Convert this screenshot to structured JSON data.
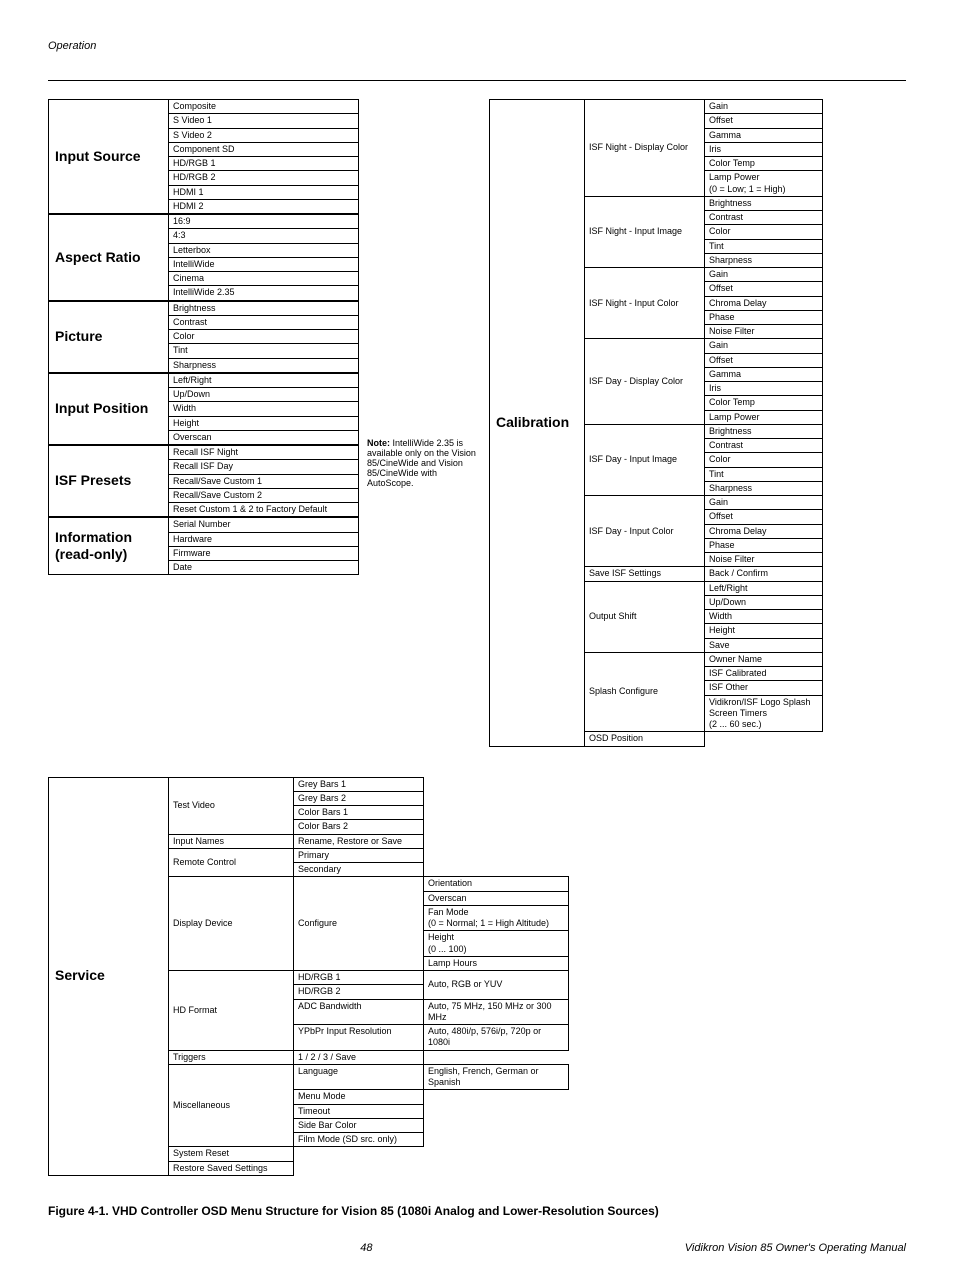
{
  "header": {
    "section": "Operation"
  },
  "left_menus": [
    {
      "title": "Input Source",
      "items": [
        "Composite",
        "S Video 1",
        "S Video 2",
        "Component SD",
        "HD/RGB 1",
        "HD/RGB 2",
        "HDMI 1",
        "HDMI 2"
      ]
    },
    {
      "title": "Aspect Ratio",
      "items": [
        "16:9",
        "4:3",
        "Letterbox",
        "IntelliWide",
        "Cinema",
        "IntelliWide 2.35"
      ]
    },
    {
      "title": "Picture",
      "items": [
        "Brightness",
        "Contrast",
        "Color",
        "Tint",
        "Sharpness"
      ]
    },
    {
      "title": "Input Position",
      "items": [
        "Left/Right",
        "Up/Down",
        "Width",
        "Height",
        "Overscan"
      ]
    },
    {
      "title": "ISF Presets",
      "items": [
        "Recall ISF Night",
        "Recall ISF Day",
        "Recall/Save Custom 1",
        "Recall/Save Custom 2",
        "Reset Custom 1 & 2 to Factory Default"
      ]
    },
    {
      "title": "Information (read-only)",
      "items": [
        "Serial Number",
        "Hardware",
        "Firmware",
        "Date"
      ]
    }
  ],
  "note": {
    "bold": "Note:",
    "text": " IntelliWide 2.35 is available only on the Vision 85/CineWide and Vision 85/CineWide with AutoScope."
  },
  "calibration": {
    "title": "Calibration",
    "groups": [
      {
        "label": "ISF Night - Display Color",
        "items": [
          "Gain",
          "Offset",
          "Gamma",
          "Iris",
          "Color Temp",
          "Lamp Power\n(0 = Low; 1 = High)"
        ]
      },
      {
        "label": "ISF Night - Input Image",
        "items": [
          "Brightness",
          "Contrast",
          "Color",
          "Tint",
          "Sharpness"
        ]
      },
      {
        "label": "ISF Night - Input Color",
        "items": [
          "Gain",
          "Offset",
          "Chroma Delay",
          "Phase",
          "Noise Filter"
        ]
      },
      {
        "label": "ISF Day - Display Color",
        "items": [
          "Gain",
          "Offset",
          "Gamma",
          "Iris",
          "Color Temp",
          "Lamp Power"
        ]
      },
      {
        "label": "ISF Day - Input Image",
        "items": [
          "Brightness",
          "Contrast",
          "Color",
          "Tint",
          "Sharpness"
        ]
      },
      {
        "label": "ISF Day - Input Color",
        "items": [
          "Gain",
          "Offset",
          "Chroma Delay",
          "Phase",
          "Noise Filter"
        ]
      },
      {
        "label": "Save ISF Settings",
        "items": [
          "Back / Confirm"
        ]
      },
      {
        "label": "Output Shift",
        "items": [
          "Left/Right",
          "Up/Down",
          "Width",
          "Height",
          "Save"
        ]
      },
      {
        "label": "Splash Configure",
        "items": [
          "Owner Name",
          "ISF Calibrated",
          "ISF Other",
          "Vidikron/ISF Logo Splash Screen Timers\n(2 ... 60 sec.)"
        ]
      },
      {
        "label": "OSD Position",
        "items": []
      }
    ]
  },
  "service": {
    "title": "Service",
    "rows": [
      {
        "sub": "Test Video",
        "sub2": [
          "Grey Bars 1",
          "Grey Bars 2",
          "Color Bars 1",
          "Color Bars 2"
        ],
        "sub3": []
      },
      {
        "sub": "Input Names",
        "sub2": [
          "Rename, Restore or Save"
        ],
        "sub3": []
      },
      {
        "sub": "Remote Control",
        "sub2": [
          "Primary",
          "Secondary"
        ],
        "sub3": []
      },
      {
        "sub": "Display Device",
        "sub2": [
          "Configure"
        ],
        "sub3": [
          "Orientation",
          "Overscan",
          "Fan Mode\n(0 = Normal; 1 = High Altitude)",
          "Height\n(0 ... 100)",
          "Lamp Hours"
        ]
      },
      {
        "sub": "HD Format",
        "sub2": [
          "HD/RGB 1",
          "HD/RGB 2",
          "ADC Bandwidth",
          "YPbPr Input Resolution"
        ],
        "sub3": [
          "Auto, RGB or YUV",
          "",
          "Auto, 75 MHz, 150 MHz or 300 MHz",
          "Auto, 480i/p, 576i/p, 720p or 1080i"
        ]
      },
      {
        "sub": "Triggers",
        "sub2": [
          "1 / 2 / 3 / Save"
        ],
        "sub3": []
      },
      {
        "sub": "Miscellaneous",
        "sub2": [
          "Language",
          "Menu Mode",
          "Timeout",
          "Side Bar Color",
          "Film Mode (SD src. only)"
        ],
        "sub3": [
          "English, French, German or Spanish",
          "",
          "",
          "",
          ""
        ]
      },
      {
        "sub": "System Reset",
        "sub2": [],
        "sub3": []
      },
      {
        "sub": "Restore Saved Settings",
        "sub2": [],
        "sub3": []
      }
    ]
  },
  "caption": "Figure 4-1. VHD Controller OSD Menu Structure for Vision 85 (1080i Analog and Lower-Resolution Sources)",
  "footer": {
    "page": "48",
    "manual": "Vidikron Vision 85 Owner's Operating Manual"
  }
}
